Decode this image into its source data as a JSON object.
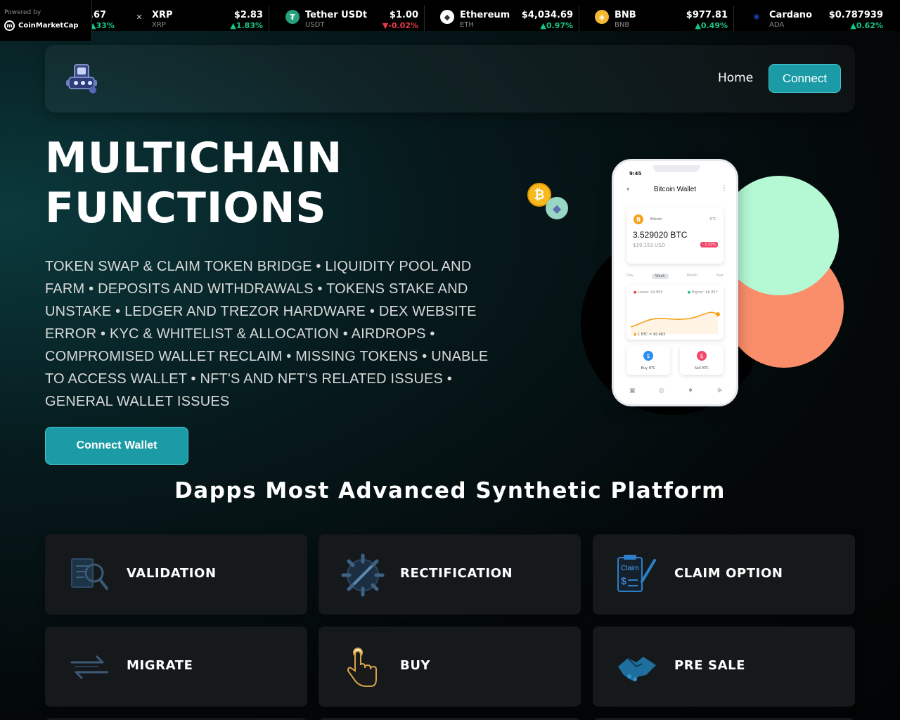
{
  "ticker": {
    "powered_label": "Powered by",
    "brand": "CoinMarketCap",
    "coins": [
      {
        "name": "",
        "symbol": "",
        "price": ".67",
        "change": "33%",
        "direction": "up",
        "icon": "partial-coin"
      },
      {
        "name": "XRP",
        "symbol": "XRP",
        "price": "$2.83",
        "change": "1.83%",
        "direction": "up",
        "icon": "xrp-icon",
        "color": "#ffffff"
      },
      {
        "name": "Tether USDt",
        "symbol": "USDT",
        "price": "$1.00",
        "change": "-0.02%",
        "direction": "down",
        "icon": "tether-icon",
        "color": "#26a17b"
      },
      {
        "name": "Ethereum",
        "symbol": "ETH",
        "price": "$4,034.69",
        "change": "0.97%",
        "direction": "up",
        "icon": "ethereum-icon",
        "color": "#ffffff"
      },
      {
        "name": "BNB",
        "symbol": "BNB",
        "price": "$977.81",
        "change": "0.49%",
        "direction": "up",
        "icon": "bnb-icon",
        "color": "#f3ba2f"
      },
      {
        "name": "Cardano",
        "symbol": "ADA",
        "price": "$0.787939",
        "change": "0.62%",
        "direction": "up",
        "icon": "cardano-icon",
        "color": "#0033ad"
      }
    ]
  },
  "nav": {
    "home": "Home",
    "connect": "Connect"
  },
  "hero": {
    "title_line1": "MULTICHAIN",
    "title_line2": "FUNCTIONS",
    "description": "TOKEN SWAP & CLAIM TOKEN BRIDGE • LIQUIDITY POOL AND FARM • DEPOSITS AND WITHDRAWALS • TOKENS STAKE AND UNSTAKE • LEDGER AND TREZOR HARDWARE • DEX WEBSITE ERROR • KYC & WHITELIST & ALLOCATION • AIRDROPS • COMPROMISED WALLET RECLAIM • MISSING TOKENS • UNABLE TO ACCESS WALLET • NFT'S AND NFT'S RELATED ISSUES • GENERAL WALLET ISSUES",
    "cta": "Connect Wallet"
  },
  "phone": {
    "time": "9:45",
    "title": "Bitcoin Wallet",
    "coin_name": "Bitcoin",
    "coin_symbol": "BTC",
    "amount": "3.529020 BTC",
    "usd": "$19.153 USD",
    "change": "- 2.32%",
    "tabs": [
      "Day",
      "Week",
      "Month",
      "Year"
    ],
    "lower": "Lower: $4.895",
    "higher": "Higher: $6.857",
    "rate": "1 BTC = $5.483",
    "buy": "Buy BTC",
    "sell": "Sell BTC"
  },
  "section": {
    "title": "Dapps Most Advanced Synthetic Platform"
  },
  "cards": [
    {
      "label": "VALIDATION",
      "icon": "validation-icon"
    },
    {
      "label": "RECTIFICATION",
      "icon": "rectification-icon"
    },
    {
      "label": "CLAIM OPTION",
      "icon": "claim-icon"
    },
    {
      "label": "MIGRATE",
      "icon": "migrate-icon"
    },
    {
      "label": "BUY",
      "icon": "buy-icon"
    },
    {
      "label": "PRE SALE",
      "icon": "presale-icon"
    }
  ],
  "colors": {
    "accent": "#1b9ba6",
    "up": "#16c784",
    "down": "#ea3943",
    "green_circle": "#b4f8d4",
    "orange_circle": "#fb8e6a"
  }
}
